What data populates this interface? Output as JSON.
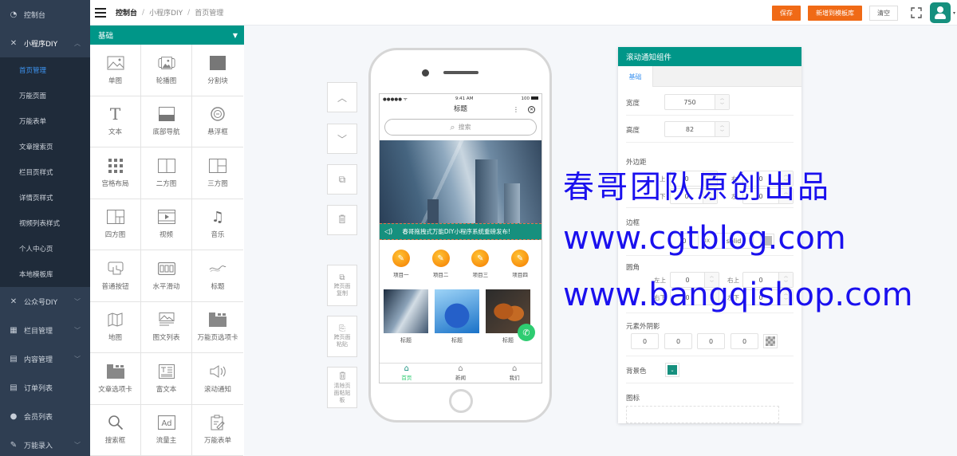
{
  "sidebar": {
    "items": [
      {
        "label": "控制台",
        "icon": "dashboard-icon",
        "glyph": "◔"
      },
      {
        "label": "小程序DIY",
        "icon": "tools-icon",
        "glyph": "✕",
        "expanded": true,
        "chevron": "︿"
      }
    ],
    "sub_items": [
      {
        "label": "首页管理",
        "active": true
      },
      {
        "label": "万能页面"
      },
      {
        "label": "万能表单"
      },
      {
        "label": "文章搜索页"
      },
      {
        "label": "栏目页样式"
      },
      {
        "label": "详情页样式"
      },
      {
        "label": "视频列表样式"
      },
      {
        "label": "个人中心页"
      },
      {
        "label": "本地模板库"
      }
    ],
    "bottom_items": [
      {
        "label": "公众号DIY",
        "icon": "tools-icon",
        "glyph": "✕",
        "chevron": "﹀"
      },
      {
        "label": "栏目管理",
        "icon": "grid-icon",
        "glyph": "▦",
        "chevron": "﹀"
      },
      {
        "label": "内容管理",
        "icon": "document-icon",
        "glyph": "▤",
        "chevron": "﹀"
      },
      {
        "label": "订单列表",
        "icon": "document-icon",
        "glyph": "▤"
      },
      {
        "label": "会员列表",
        "icon": "user-icon",
        "glyph": "●"
      },
      {
        "label": "万能录入",
        "icon": "pen-icon",
        "glyph": "✎",
        "chevron": "﹀"
      }
    ]
  },
  "topbar": {
    "breadcrumb": [
      "控制台",
      "小程序DIY",
      "首页管理"
    ],
    "separator": "/",
    "save_label": "保存",
    "add_template_label": "新增到模板库",
    "clear_label": "清空",
    "caret": "▾"
  },
  "palette": {
    "header": "基础",
    "toggle": "▼",
    "components": [
      {
        "label": "单图",
        "icon": "image-icon"
      },
      {
        "label": "轮播图",
        "icon": "carousel-icon"
      },
      {
        "label": "分割块",
        "icon": "divider-block-icon"
      },
      {
        "label": "文本",
        "icon": "text-icon"
      },
      {
        "label": "底部导航",
        "icon": "bottom-nav-icon"
      },
      {
        "label": "悬浮框",
        "icon": "float-box-icon"
      },
      {
        "label": "宫格布局",
        "icon": "grid-layout-icon"
      },
      {
        "label": "二方图",
        "icon": "two-panel-icon"
      },
      {
        "label": "三方图",
        "icon": "three-panel-icon"
      },
      {
        "label": "四方图",
        "icon": "four-panel-icon"
      },
      {
        "label": "视频",
        "icon": "video-icon"
      },
      {
        "label": "音乐",
        "icon": "music-icon"
      },
      {
        "label": "普通按钮",
        "icon": "button-icon"
      },
      {
        "label": "水平滑动",
        "icon": "horizontal-scroll-icon"
      },
      {
        "label": "标题",
        "icon": "title-icon"
      },
      {
        "label": "地图",
        "icon": "map-icon"
      },
      {
        "label": "图文列表",
        "icon": "image-text-list-icon"
      },
      {
        "label": "万能页选项卡",
        "icon": "page-tab-icon"
      },
      {
        "label": "文章选项卡",
        "icon": "article-tab-icon"
      },
      {
        "label": "富文本",
        "icon": "rich-text-icon"
      },
      {
        "label": "滚动通知",
        "icon": "speaker-icon"
      },
      {
        "label": "搜索框",
        "icon": "search-icon"
      },
      {
        "label": "流量主",
        "icon": "ad-icon"
      },
      {
        "label": "万能表单",
        "icon": "form-icon"
      }
    ]
  },
  "tools": {
    "move_up": "︿",
    "move_down": "﹀",
    "copy": "⧉",
    "delete": "🗑",
    "cross_copy": "跨页面复制",
    "cross_paste": "跨页面粘贴",
    "clear_paste": "清除页面粘贴板"
  },
  "phone": {
    "status_left": "●●●●● ᯤ",
    "time": "9:41 AM",
    "battery": "100",
    "title": "标题",
    "more": "⋮",
    "close": "✕",
    "search_placeholder": "搜索",
    "search_glyph": "⌕",
    "notice_text": "春哥拖拽式万能DIY小程序系统重磅发布!",
    "notice_glyph": "◁)",
    "grid_items": [
      {
        "label": "项目一"
      },
      {
        "label": "项目二"
      },
      {
        "label": "项目三"
      },
      {
        "label": "项目四"
      }
    ],
    "grid_glyph": "✎",
    "thumbs": [
      {
        "label": "标题"
      },
      {
        "label": "标题"
      },
      {
        "label": "标题"
      }
    ],
    "call_glyph": "✆",
    "tabs": [
      {
        "label": "首页",
        "active": true
      },
      {
        "label": "新闻"
      },
      {
        "label": "我们"
      }
    ],
    "home_glyph": "⌂"
  },
  "props": {
    "title": "滚动通知组件",
    "tab": "基础",
    "width_label": "宽度",
    "width_value": "750",
    "height_label": "高度",
    "height_value": "82",
    "margin_label": "外边距",
    "margin": {
      "top_label": "上",
      "top": "0",
      "right_label": "右",
      "right": "0",
      "bottom_label": "下",
      "bottom": "0",
      "left_label": "左",
      "left": "0"
    },
    "border_label": "边框",
    "border_width": "0",
    "border_unit": "px",
    "border_style": "solid",
    "radius_label": "圆角",
    "radius": {
      "tl_label": "左上",
      "tl": "0",
      "tr_label": "右上",
      "tr": "0",
      "br_label": "右下",
      "br": "0",
      "bl_label": "左下",
      "bl": "0"
    },
    "shadow_label": "元素外阴影",
    "shadow": [
      "0",
      "0",
      "0",
      "0"
    ],
    "bg_label": "背景色",
    "bg_color": "#16907e",
    "icon_label": "图标",
    "spin_up": "︿",
    "spin_down": "﹀"
  },
  "watermark": {
    "line1": "春哥团队原创出品",
    "line2": "www.cgtblog.com",
    "line3": "www.bangqishop.com",
    "color": "#1a10ee"
  },
  "colors": {
    "primary": "#009688",
    "accent": "#f06a16",
    "sidebar": "#2f3e52",
    "active_link": "#3c93f0"
  }
}
